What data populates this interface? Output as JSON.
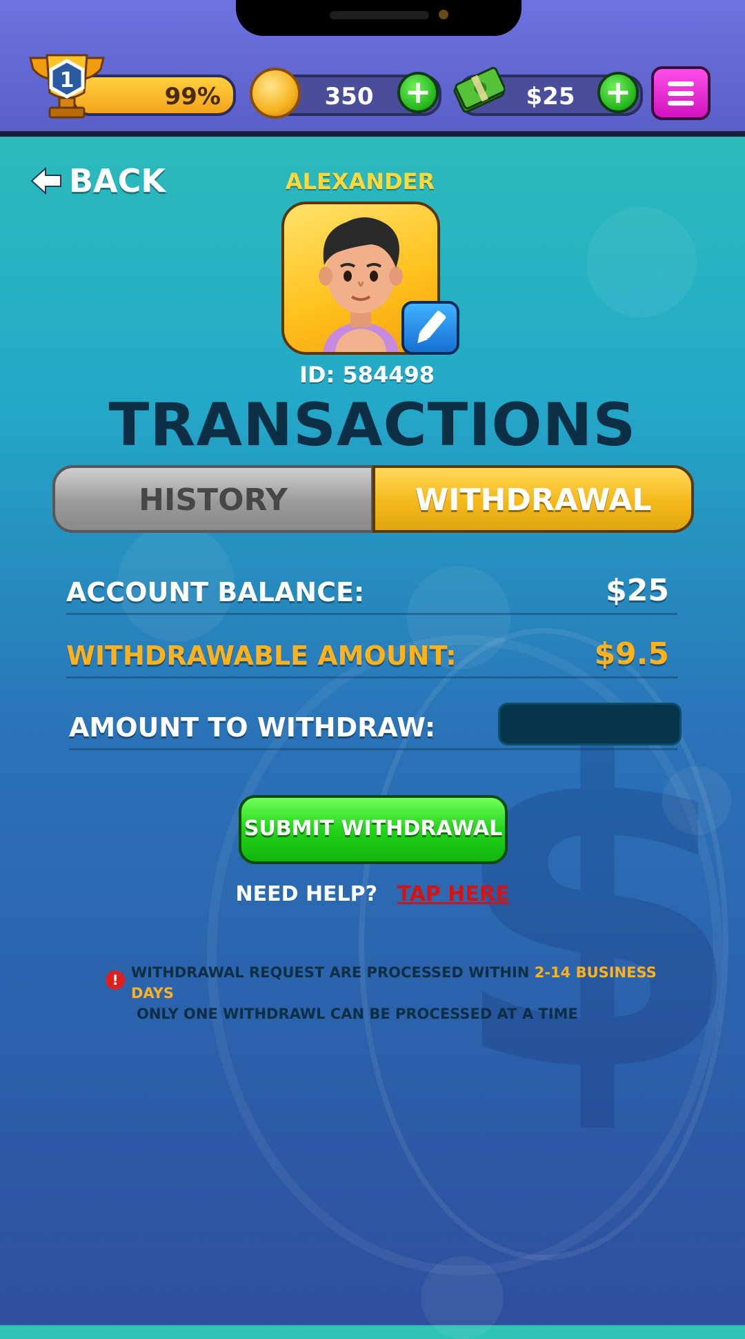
{
  "topbar": {
    "level": "1",
    "progress_percent": 99,
    "progress_label": "99%",
    "coins": "350",
    "cash": "$25"
  },
  "header": {
    "back_label": "BACK",
    "player_name": "ALEXANDER",
    "player_id": "ID: 584498",
    "title": "TRANSACTIONS"
  },
  "tabs": {
    "items": [
      {
        "label": "HISTORY",
        "active": false
      },
      {
        "label": "WITHDRAWAL",
        "active": true
      }
    ]
  },
  "withdrawal": {
    "balance_label": "ACCOUNT BALANCE:",
    "balance_value": "$25",
    "withdrawable_label": "WITHDRAWABLE AMOUNT:",
    "withdrawable_value": "$9.5",
    "amount_label": "AMOUNT TO WITHDRAW:",
    "amount_value": "",
    "submit_label": "SUBMIT WITHDRAWAL"
  },
  "help": {
    "text": "NEED HELP?",
    "link": "TAP HERE"
  },
  "notice": {
    "line1_prefix": "WITHDRAWAL REQUEST ARE PROCESSED WITHIN ",
    "line1_highlight": "2-14 BUSINESS DAYS",
    "line2": "ONLY ONE WITHDRAWL CAN BE PROCESSED AT A TIME"
  },
  "colors": {
    "accent_gold": "#ffb21c",
    "name_yellow": "#ffd83a",
    "link_red": "#d41414",
    "submit_green": "#22d41a",
    "title_navy": "#0c2f45"
  },
  "icons": {
    "level_badge": "trophy-icon",
    "coin": "coin-icon",
    "cash": "cash-stack-icon",
    "add": "plus-icon",
    "menu": "hamburger-icon",
    "back": "arrow-left-icon",
    "edit": "pencil-icon",
    "notice": "exclamation-icon"
  }
}
